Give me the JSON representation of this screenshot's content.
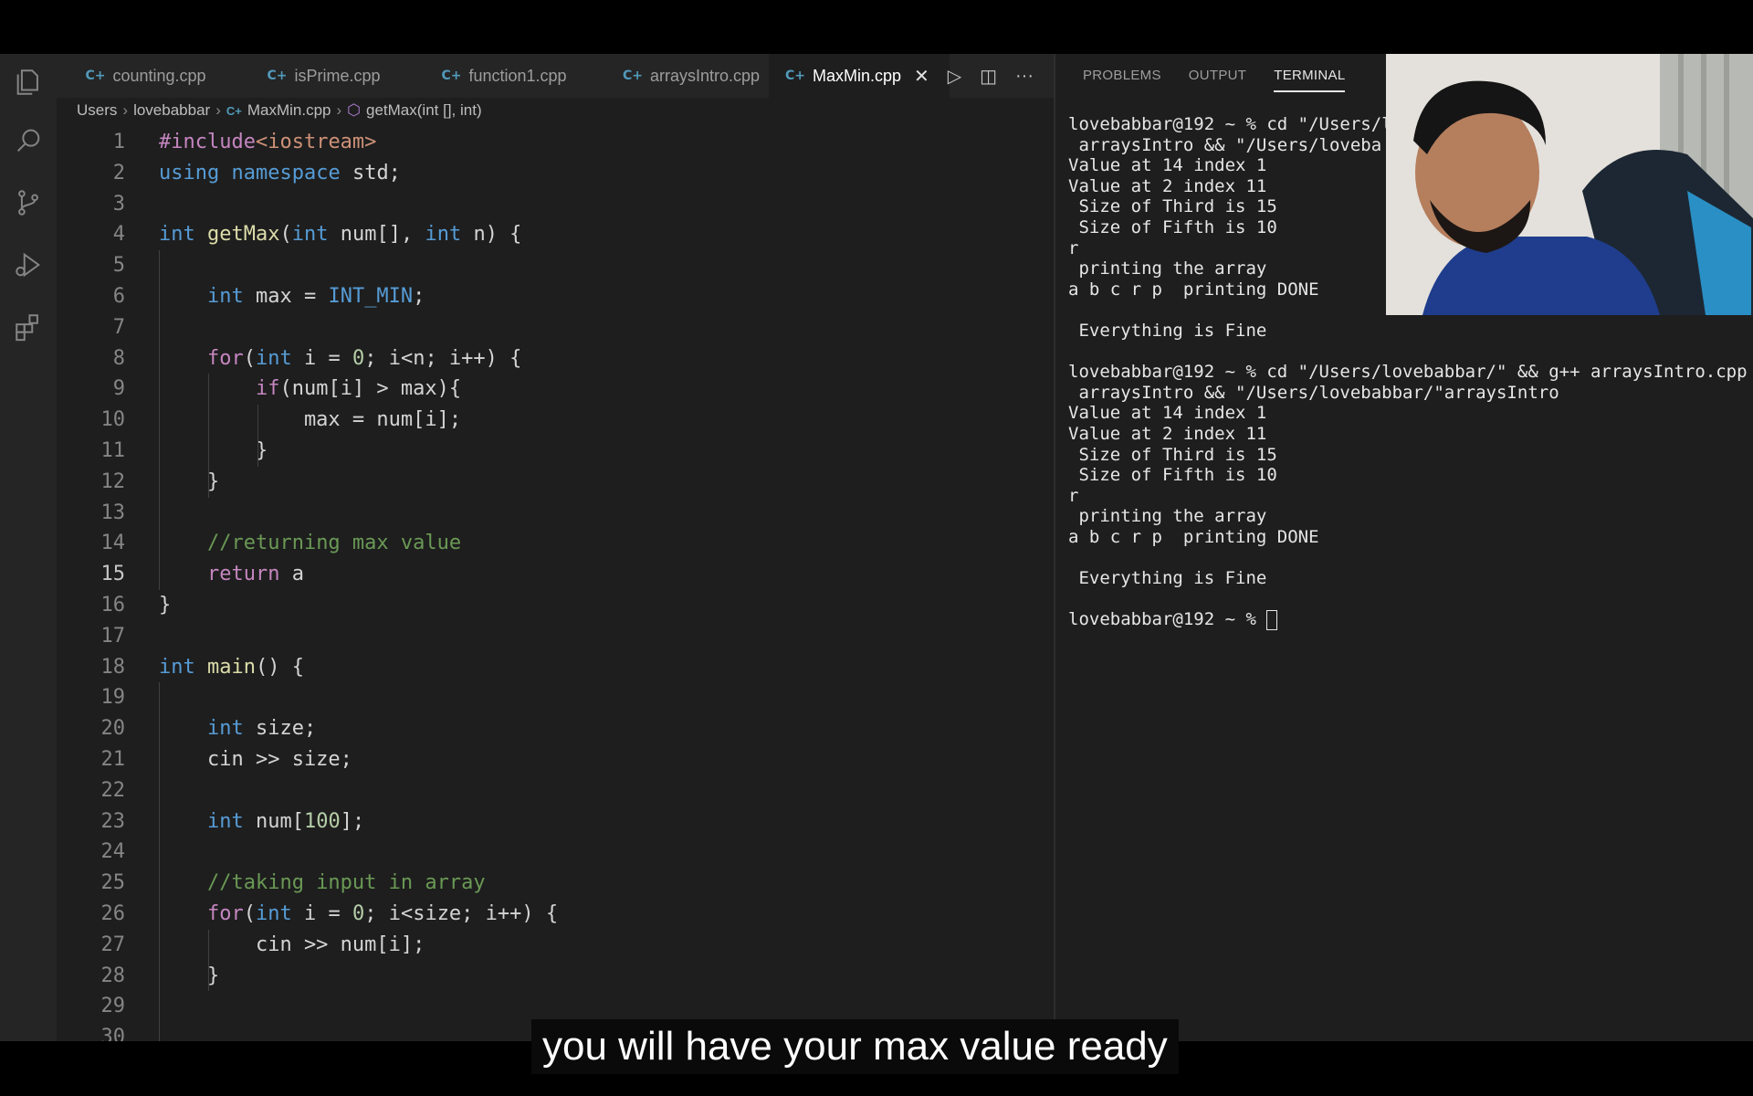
{
  "editor": {
    "tabs": [
      {
        "label": "counting.cpp",
        "active": false
      },
      {
        "label": "isPrime.cpp",
        "active": false
      },
      {
        "label": "function1.cpp",
        "active": false
      },
      {
        "label": "arraysIntro.cpp",
        "active": false
      },
      {
        "label": "MaxMin.cpp",
        "active": true
      }
    ],
    "breadcrumb": [
      "Users",
      "lovebabbar",
      "MaxMin.cpp",
      "getMax(int [], int)"
    ],
    "code_lines": [
      {
        "n": "1",
        "text": "#include<iostream>"
      },
      {
        "n": "2",
        "text": "using namespace std;"
      },
      {
        "n": "3",
        "text": ""
      },
      {
        "n": "4",
        "text": "int getMax(int num[], int n) {"
      },
      {
        "n": "5",
        "text": ""
      },
      {
        "n": "6",
        "text": "    int max = INT_MIN;"
      },
      {
        "n": "7",
        "text": ""
      },
      {
        "n": "8",
        "text": "    for(int i = 0; i<n; i++) {"
      },
      {
        "n": "9",
        "text": "        if(num[i] > max){"
      },
      {
        "n": "10",
        "text": "            max = num[i];"
      },
      {
        "n": "11",
        "text": "        }"
      },
      {
        "n": "12",
        "text": "    }"
      },
      {
        "n": "13",
        "text": ""
      },
      {
        "n": "14",
        "text": "    //returning max value"
      },
      {
        "n": "15",
        "text": "    return a"
      },
      {
        "n": "16",
        "text": "}"
      },
      {
        "n": "17",
        "text": ""
      },
      {
        "n": "18",
        "text": "int main() {"
      },
      {
        "n": "19",
        "text": ""
      },
      {
        "n": "20",
        "text": "    int size;"
      },
      {
        "n": "21",
        "text": "    cin >> size;"
      },
      {
        "n": "22",
        "text": ""
      },
      {
        "n": "23",
        "text": "    int num[100];"
      },
      {
        "n": "24",
        "text": ""
      },
      {
        "n": "25",
        "text": "    //taking input in array"
      },
      {
        "n": "26",
        "text": "    for(int i = 0; i<size; i++) {"
      },
      {
        "n": "27",
        "text": "        cin >> num[i];"
      },
      {
        "n": "28",
        "text": "    }"
      },
      {
        "n": "29",
        "text": ""
      },
      {
        "n": "30",
        "text": ""
      }
    ]
  },
  "panel": {
    "tabs": [
      "PROBLEMS",
      "OUTPUT",
      "TERMINAL"
    ],
    "active_tab": "TERMINAL",
    "terminal_lines": [
      "lovebabbar@192 ~ % cd \"/Users/l",
      " arraysIntro && \"/Users/loveba",
      "Value at 14 index 1",
      "Value at 2 index 11",
      " Size of Third is 15",
      " Size of Fifth is 10",
      "r",
      " printing the array",
      "a b c r p  printing DONE",
      "",
      " Everything is Fine",
      "",
      "lovebabbar@192 ~ % cd \"/Users/lovebabbar/\" && g++ arraysIntro.cpp -",
      " arraysIntro && \"/Users/lovebabbar/\"arraysIntro",
      "Value at 14 index 1",
      "Value at 2 index 11",
      " Size of Third is 15",
      " Size of Fifth is 10",
      "r",
      " printing the array",
      "a b c r p  printing DONE",
      "",
      " Everything is Fine",
      "",
      "lovebabbar@192 ~ % "
    ]
  },
  "caption": "you will have your max value ready",
  "icons": {
    "activity": [
      "files-icon",
      "search-icon",
      "source-control-icon",
      "run-debug-icon",
      "extensions-icon"
    ],
    "tab_actions": [
      "run-icon",
      "split-editor-icon",
      "more-icon"
    ]
  },
  "colors": {
    "editor_bg": "#1e1e1e",
    "keyword": "#569cd6",
    "comment": "#6a9955",
    "string": "#ce9178",
    "number": "#b5cea8"
  }
}
